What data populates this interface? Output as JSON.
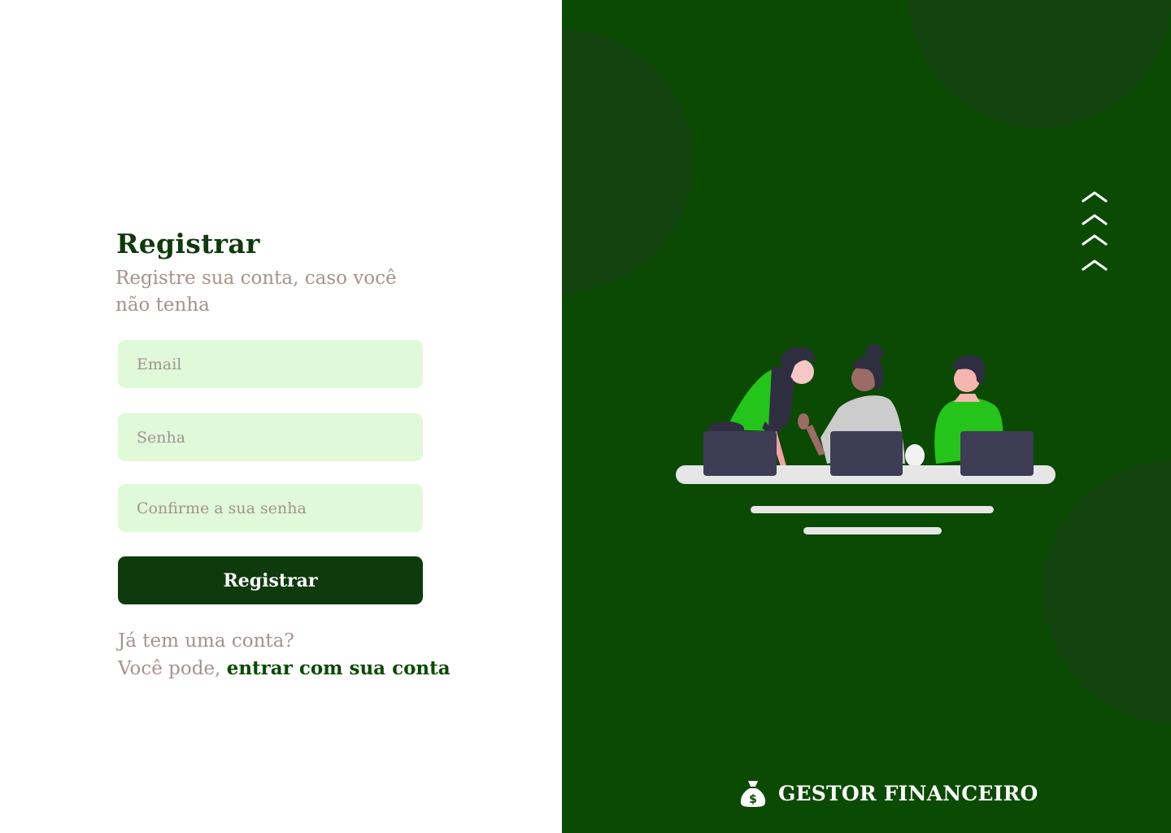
{
  "form": {
    "title": "Registrar",
    "subtitle": "Registre sua conta, caso você não tenha",
    "email_placeholder": "Email",
    "password_placeholder": "Senha",
    "confirm_placeholder": "Confirme a sua senha",
    "submit_label": "Registrar",
    "login_line1": "Já tem uma conta?",
    "login_line2_prefix": "Você pode, ",
    "login_link": "entrar com sua conta"
  },
  "brand": {
    "name": "GESTOR FINANCEIRO",
    "icon": "money-bag-icon"
  },
  "decor": {
    "chevron_icon": "chevrons-up-icon",
    "illustration": "team-working-laptops-illustration"
  },
  "colors": {
    "primary_dark": "#0f3a0c",
    "panel_green": "#0a4a02",
    "input_bg": "#dff9d9",
    "muted_text": "#a3938f",
    "accent_green": "#25c41a"
  }
}
